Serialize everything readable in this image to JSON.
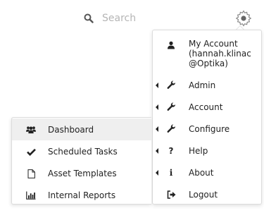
{
  "search": {
    "placeholder": "Search",
    "icon": "search-icon"
  },
  "settings": {
    "icon": "gear-icon"
  },
  "menu": {
    "account": {
      "title": "My Account",
      "user_line1": "(hannah.klinac",
      "user_line2": "@Optika)",
      "icon": "user-icon"
    },
    "items": [
      {
        "label": "Admin",
        "icon": "wrench-icon",
        "has_submenu": true
      },
      {
        "label": "Account",
        "icon": "wrench-icon",
        "has_submenu": true
      },
      {
        "label": "Configure",
        "icon": "wrench-icon",
        "has_submenu": true
      },
      {
        "label": "Help",
        "icon": "question-icon",
        "has_submenu": true
      },
      {
        "label": "About",
        "icon": "info-icon",
        "has_submenu": true
      },
      {
        "label": "Logout",
        "icon": "sign-out-icon",
        "has_submenu": false
      }
    ]
  },
  "submenu": {
    "items": [
      {
        "label": "Dashboard",
        "icon": "users-icon",
        "active": true
      },
      {
        "label": "Scheduled Tasks",
        "icon": "check-icon",
        "active": false
      },
      {
        "label": "Asset Templates",
        "icon": "file-icon",
        "active": false
      },
      {
        "label": "Internal Reports",
        "icon": "bar-chart-icon",
        "active": false
      }
    ]
  },
  "colors": {
    "text": "#222222",
    "placeholder": "#b5b5b5",
    "border": "#dcdcdc",
    "active_bg": "#efefef"
  }
}
